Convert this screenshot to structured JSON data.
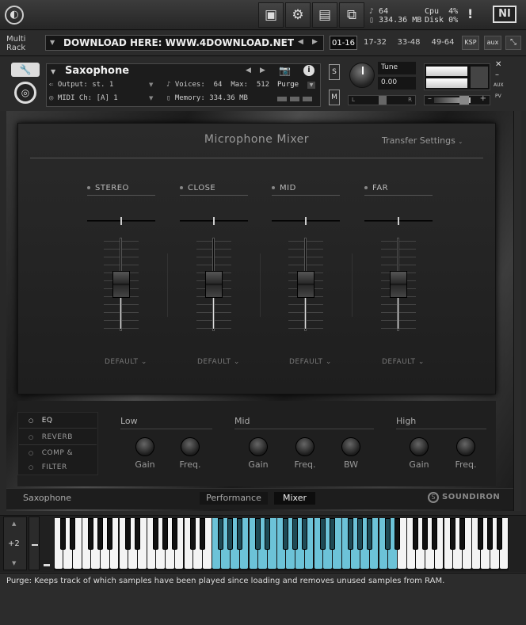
{
  "topbar": {
    "stats_voices": "64",
    "stats_memory": "334.36 MB",
    "cpu_label": "Cpu",
    "cpu_value": "4%",
    "disk_label": "Disk",
    "disk_value": "0%",
    "warning": "!",
    "ni_logo": "NI",
    "icons": [
      "kontakt-logo-icon",
      "save-icon",
      "gear-icon",
      "layout-icon",
      "resize-icon",
      "warning-icon",
      "ni-logo-icon"
    ]
  },
  "rack": {
    "label_line1": "Multi",
    "label_line2": "Rack",
    "name": "DOWNLOAD HERE: WWW.4DOWNLOAD.NET",
    "tabs": [
      "01-16",
      "17-32",
      "33-48",
      "49-64"
    ],
    "selected_tab": "01-16",
    "ksp": "KSP",
    "aux": "aux"
  },
  "instrument": {
    "name": "Saxophone",
    "output_label": "Output:",
    "output_value": "st. 1",
    "voices_label": "Voices:",
    "voices_value": "64",
    "max_label": "Max:",
    "max_value": "512",
    "purge": "Purge",
    "midi_label": "MIDI Ch:",
    "midi_value": "[A] 1",
    "memory_label": "Memory:",
    "memory_value": "334.36 MB",
    "tune_label": "Tune",
    "tune_value": "0.00",
    "s_btn": "S",
    "m_btn": "M",
    "pan_l": "L",
    "pan_r": "R",
    "aux_label": "AUX",
    "pv_label": "PV"
  },
  "mixer": {
    "title": "Microphone Mixer",
    "transfer": "Transfer Settings",
    "channels": [
      {
        "name": "STEREO",
        "preset": "DEFAULT"
      },
      {
        "name": "CLOSE",
        "preset": "DEFAULT"
      },
      {
        "name": "MID",
        "preset": "DEFAULT"
      },
      {
        "name": "FAR",
        "preset": "DEFAULT"
      }
    ]
  },
  "fx": {
    "items": [
      "EQ",
      "REVERB",
      "COMP &",
      "FILTER"
    ],
    "selected": "EQ",
    "bands": {
      "low": {
        "title": "Low",
        "knobs": [
          "Gain",
          "Freq."
        ]
      },
      "mid": {
        "title": "Mid",
        "knobs": [
          "Gain",
          "Freq.",
          "BW"
        ]
      },
      "high": {
        "title": "High",
        "knobs": [
          "Gain",
          "Freq."
        ]
      }
    }
  },
  "footer": {
    "instrument": "Saxophone",
    "tabs": [
      "Performance",
      "Mixer"
    ],
    "selected_tab": "Mixer",
    "brand": "SOUNDIRON"
  },
  "keyboard": {
    "octave": "+2"
  },
  "status": {
    "text": "Purge: Keeps track of which samples have been played since loading and removes unused samples from RAM."
  },
  "colors": {
    "key_highlight": "#6cc3d8",
    "accent": "#ffffff"
  }
}
